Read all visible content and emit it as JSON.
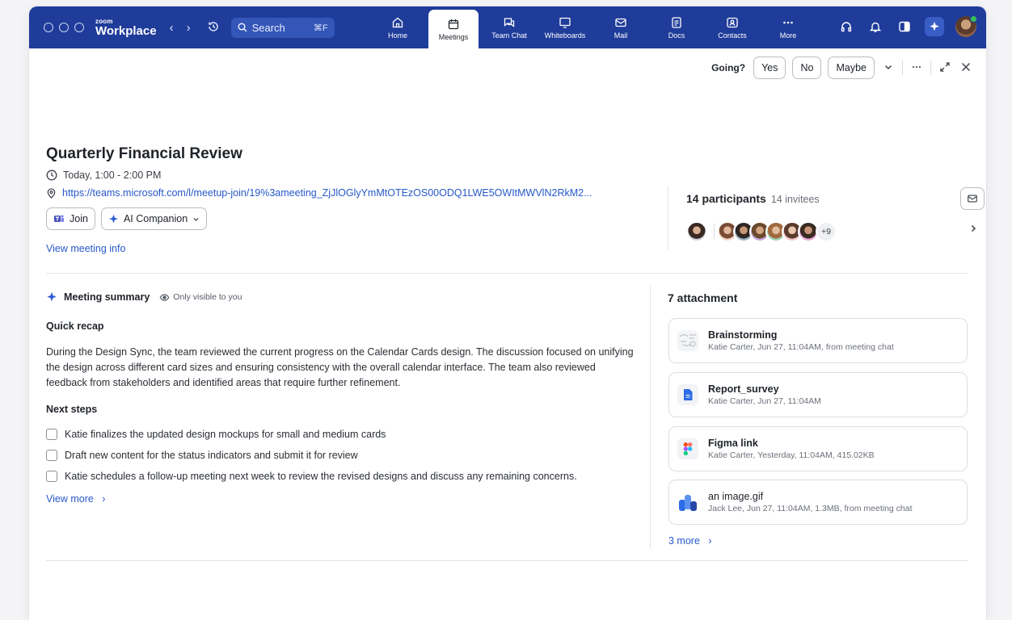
{
  "app": {
    "brand_small": "zoom",
    "brand_big": "Workplace",
    "search_placeholder": "Search",
    "search_shortcut": "⌘F"
  },
  "nav_tabs": [
    {
      "label": "Home",
      "icon": "home-icon",
      "active": false
    },
    {
      "label": "Meetings",
      "icon": "calendar-icon",
      "active": true
    },
    {
      "label": "Team Chat",
      "icon": "chat-icon",
      "active": false
    },
    {
      "label": "Whiteboards",
      "icon": "whiteboard-icon",
      "active": false
    },
    {
      "label": "Mail",
      "icon": "mail-icon",
      "active": false
    },
    {
      "label": "Docs",
      "icon": "docs-icon",
      "active": false
    },
    {
      "label": "Contacts",
      "icon": "contacts-icon",
      "active": false
    },
    {
      "label": "More",
      "icon": "more-icon",
      "active": false
    }
  ],
  "rsvp": {
    "label": "Going?",
    "yes": "Yes",
    "no": "No",
    "maybe": "Maybe"
  },
  "meeting": {
    "title": "Quarterly Financial Review",
    "time": "Today, 1:00 - 2:00 PM",
    "url": "https://teams.microsoft.com/l/meetup-join/19%3ameeting_ZjJlOGlyYmMtOTEzOS00ODQ1LWE5OWItMWVlN2RkM2...",
    "join_label": "Join",
    "ai_label": "AI Companion",
    "view_info": "View meeting info"
  },
  "participants": {
    "title": "14 participants",
    "invitees": "14 invitees",
    "more_count": "+9"
  },
  "summary": {
    "heading": "Meeting summary",
    "visibility": "Only visible to you",
    "recap_title": "Quick recap",
    "recap": "During the Design Sync, the team reviewed the current progress on the Calendar Cards design. The discussion focused on unifying the design across different card sizes and ensuring consistency with the overall calendar interface. The team also reviewed feedback from stakeholders and identified areas that require further refinement.",
    "next_title": "Next steps",
    "steps": [
      "Katie finalizes the updated design mockups for small and medium cards",
      "Draft new content for the status indicators and submit it for review",
      "Katie schedules a follow-up meeting next week to review the revised designs and discuss any remaining concerns."
    ],
    "view_more": "View more"
  },
  "attachments": {
    "heading": "7 attachment",
    "items": [
      {
        "name": "Brainstorming",
        "meta": "Katie Carter, Jun 27, 11:04AM, from meeting chat",
        "icon": "whiteboard-thumb-icon"
      },
      {
        "name": "Report_survey",
        "meta": "Katie Carter, Jun 27, 11:04AM",
        "icon": "doc-file-icon"
      },
      {
        "name": "Figma link",
        "meta": "Katie Carter, Yesterday, 11:04AM, 415.02KB",
        "icon": "figma-icon"
      },
      {
        "name": "an image.gif",
        "meta": "Jack Lee, Jun 27, 11:04AM, 1.3MB, from meeting chat",
        "icon": "image-file-icon"
      }
    ],
    "more": "3 more"
  },
  "colors": {
    "titlebar": "#1f3c9a",
    "link": "#2759c9"
  }
}
